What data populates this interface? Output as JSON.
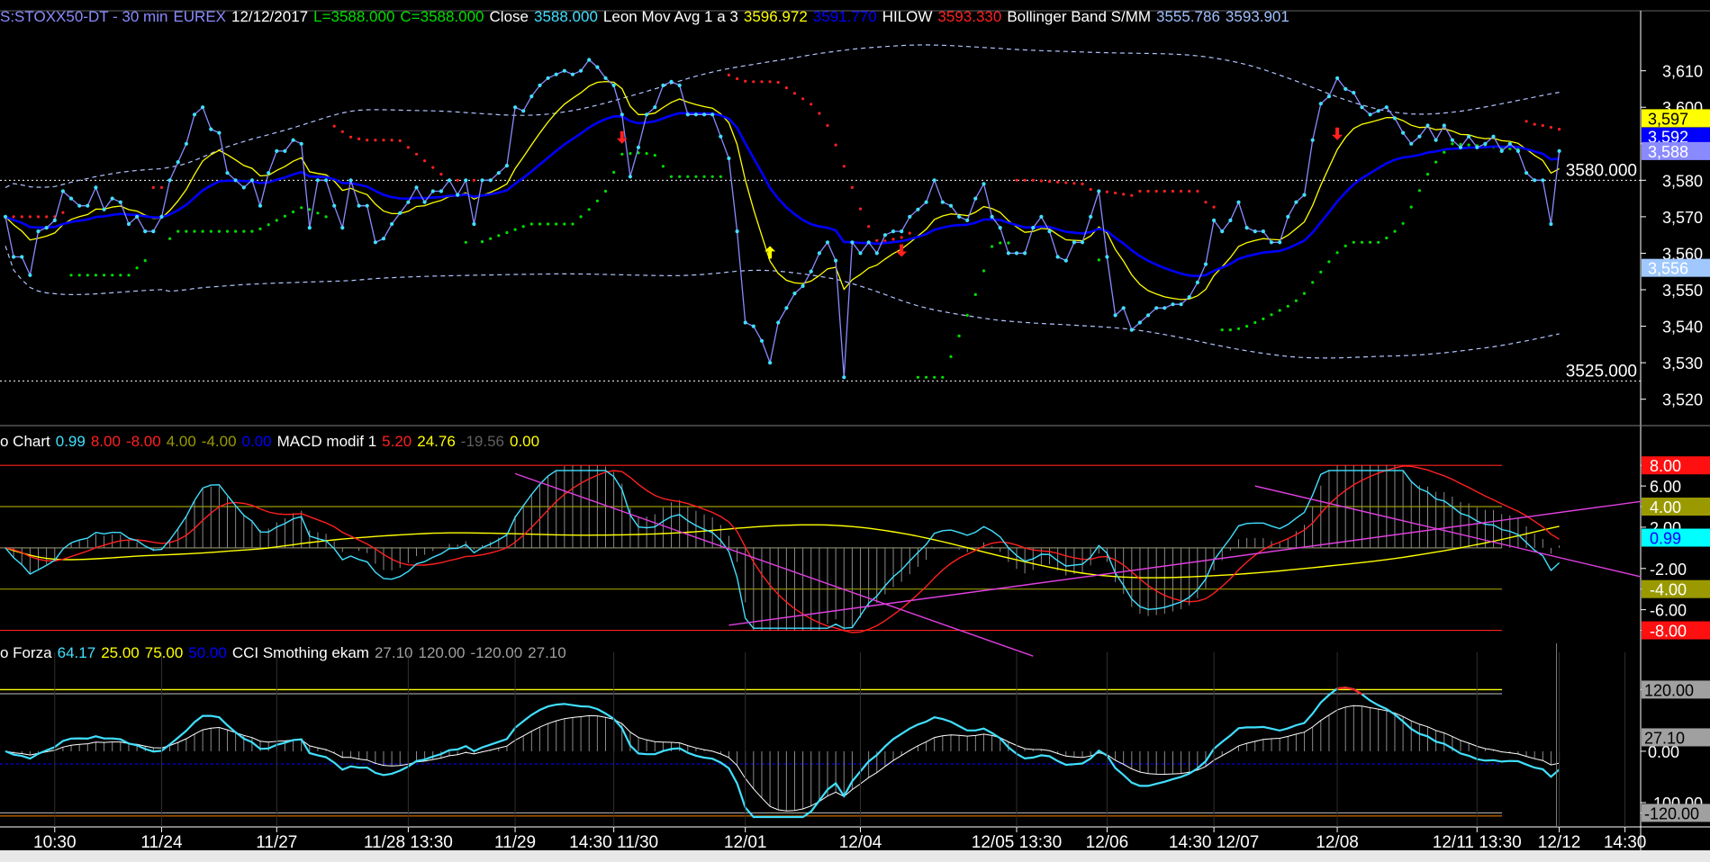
{
  "colors": {
    "background": "#000000",
    "price": "#8a8aff",
    "dots": "#40e0ff",
    "yellow": "#ffff00",
    "blue": "#0000ff",
    "red": "#ff2020",
    "green": "#00e000",
    "white": "#ffffff",
    "magenta": "#e040e0",
    "olive": "#9a9a00",
    "gray": "#a0a0a0"
  },
  "header": {
    "main": [
      {
        "text": "S:STOXX50-DT - 30 min",
        "color": "#8a8aff"
      },
      {
        "text": "EUREX",
        "color": "#8a8aff"
      },
      {
        "text": "12/12/2017",
        "color": "#ffffff"
      },
      {
        "text": "L=3588.000",
        "color": "#00e000"
      },
      {
        "text": "C=3588.000",
        "color": "#00e000"
      },
      {
        "text": "Close",
        "color": "#ffffff"
      },
      {
        "text": "3588.000",
        "color": "#40e0ff"
      },
      {
        "text": "Leon Mov Avg 1 a 3",
        "color": "#ffffff"
      },
      {
        "text": "3596.972",
        "color": "#ffff00"
      },
      {
        "text": "3591.770",
        "color": "#0000ff"
      },
      {
        "text": "HILOW",
        "color": "#ffffff"
      },
      {
        "text": "3593.330",
        "color": "#ff2020"
      },
      {
        "text": "Bollinger Band S/MM",
        "color": "#ffffff"
      },
      {
        "text": "3555.786",
        "color": "#a0c0ff"
      },
      {
        "text": "3593.901",
        "color": "#a0c0ff"
      }
    ],
    "macd": [
      {
        "text": "o Chart",
        "color": "#ffffff"
      },
      {
        "text": "0.99",
        "color": "#40e0ff"
      },
      {
        "text": "8.00",
        "color": "#ff2020"
      },
      {
        "text": "-8.00",
        "color": "#ff2020"
      },
      {
        "text": "4.00",
        "color": "#9a9a00"
      },
      {
        "text": "-4.00",
        "color": "#9a9a00"
      },
      {
        "text": "0.00",
        "color": "#0000ff"
      },
      {
        "text": "MACD modif 1",
        "color": "#ffffff"
      },
      {
        "text": "5.20",
        "color": "#ff2020"
      },
      {
        "text": "24.76",
        "color": "#ffff00"
      },
      {
        "text": "-19.56",
        "color": "#606060"
      },
      {
        "text": "0.00",
        "color": "#ffff00"
      }
    ],
    "cci": [
      {
        "text": "o Forza",
        "color": "#ffffff"
      },
      {
        "text": "64.17",
        "color": "#40e0ff"
      },
      {
        "text": "25.00",
        "color": "#ffff00"
      },
      {
        "text": "75.00",
        "color": "#ffff00"
      },
      {
        "text": "50.00",
        "color": "#0000ff"
      },
      {
        "text": "CCI Smothing ekam",
        "color": "#ffffff"
      },
      {
        "text": "27.10",
        "color": "#a0a0a0"
      },
      {
        "text": "120.00",
        "color": "#a0a0a0"
      },
      {
        "text": "-120.00",
        "color": "#a0a0a0"
      },
      {
        "text": "27.10",
        "color": "#a0a0a0"
      }
    ]
  },
  "chart_data": [
    {
      "type": "line",
      "panel": "price",
      "ylim": [
        3514,
        3622
      ],
      "y_ticks": [
        3520,
        3530,
        3540,
        3550,
        3560,
        3570,
        3580,
        3590,
        3600,
        3610
      ],
      "y_tick_labels": [
        "3,520",
        "3,530",
        "3,540",
        "3,550",
        "3,560",
        "3,570",
        "3,580",
        "3,590",
        "3,600",
        "3,610"
      ],
      "x_tick_labels": [
        {
          "label": "10:30",
          "i": 6
        },
        {
          "label": "11/24",
          "i": 19
        },
        {
          "label": "11/27",
          "i": 33
        },
        {
          "label": "11/28 13:30",
          "i": 49
        },
        {
          "label": "11/29",
          "i": 62
        },
        {
          "label": "14:30 11/30",
          "i": 74
        },
        {
          "label": "12/01",
          "i": 90
        },
        {
          "label": "12/04",
          "i": 104
        },
        {
          "label": "12/05 13:30",
          "i": 123
        },
        {
          "label": "12/06",
          "i": 134
        },
        {
          "label": "14:30 12/07",
          "i": 147
        },
        {
          "label": "12/08",
          "i": 162
        },
        {
          "label": "12/11 13:30",
          "i": 179
        },
        {
          "label": "12/12",
          "i": 189
        },
        {
          "label": "14:30",
          "i": 197
        }
      ],
      "h_levels": [
        {
          "value": 3580,
          "label": "3580.000"
        },
        {
          "value": 3525,
          "label": "3525.000"
        }
      ],
      "value_tags": [
        {
          "label": "3,597",
          "value": 3597,
          "bg": "#ffff00",
          "fg": "#000000"
        },
        {
          "label": "3,592",
          "value": 3592,
          "bg": "#0000ff",
          "fg": "#ffffff"
        },
        {
          "label": "3,588",
          "value": 3588,
          "bg": "#8a8aff",
          "fg": "#ffffff"
        },
        {
          "label": "3,556",
          "value": 3556,
          "bg": "#a0c8ff",
          "fg": "#ffffff"
        }
      ],
      "series": [
        {
          "name": "Close",
          "values": [
            3570,
            3559,
            3559,
            3554,
            3566,
            3567,
            3569,
            3577,
            3575,
            3573,
            3573,
            3578,
            3572,
            3575,
            3574,
            3568,
            3570,
            3566,
            3566,
            3570,
            3580,
            3585,
            3590,
            3598,
            3600,
            3594,
            3593,
            3582,
            3580,
            3578,
            3580,
            3573,
            3582,
            3588,
            3588,
            3591,
            3590,
            3567,
            3580,
            3580,
            3573,
            3567,
            3580,
            3573,
            3573,
            3563,
            3564,
            3568,
            3571,
            3574,
            3578,
            3574,
            3577,
            3577,
            3580,
            3576,
            3580,
            3568,
            3580,
            3580,
            3582,
            3584,
            3600,
            3599,
            3603,
            3606,
            3608,
            3609,
            3610,
            3609,
            3610,
            3613,
            3611,
            3608,
            3606,
            3598,
            3581,
            3589,
            3598,
            3600,
            3606,
            3607,
            3606,
            3598,
            3598,
            3598,
            3598,
            3592,
            3586,
            3566,
            3541,
            3540,
            3536,
            3530,
            3541,
            3545,
            3549,
            3551,
            3555,
            3560,
            3563,
            3558,
            3526,
            3563,
            3560,
            3563,
            3560,
            3565,
            3566,
            3566,
            3570,
            3572,
            3574,
            3580,
            3574,
            3573,
            3570,
            3569,
            3575,
            3579,
            3570,
            3567,
            3560,
            3560,
            3560,
            3567,
            3570,
            3566,
            3559,
            3558,
            3563,
            3563,
            3570,
            3577,
            3559,
            3543,
            3545,
            3539,
            3541,
            3543,
            3545,
            3545,
            3546,
            3546,
            3548,
            3552,
            3557,
            3569,
            3566,
            3569,
            3574,
            3567,
            3566,
            3566,
            3563,
            3563,
            3570,
            3574,
            3576,
            3591,
            3601,
            3603,
            3608,
            3605,
            3604,
            3600,
            3598,
            3599,
            3600,
            3597,
            3593,
            3590,
            3592,
            3595,
            3591,
            3595,
            3591,
            3589,
            3592,
            3589,
            3590,
            3592,
            3588,
            3590,
            3588,
            3582,
            3580,
            3580,
            3568,
            3588
          ]
        },
        {
          "name": "Leon Mov Avg 1 a 3 (yellow)",
          "color": "#ffff00"
        },
        {
          "name": "Leon Mov Avg 1 a 3 (blue)",
          "color": "#0000ff"
        },
        {
          "name": "HILOW",
          "color": "#ff2020"
        },
        {
          "name": "Bollinger Band S/MM",
          "color": "#a0c0ff"
        }
      ],
      "arrows": [
        {
          "i": 75,
          "value": 3590,
          "dir": "down",
          "color": "#ff2020"
        },
        {
          "i": 93,
          "value": 3562,
          "dir": "up",
          "color": "#ffff00"
        },
        {
          "i": 109,
          "value": 3559,
          "dir": "down",
          "color": "#ff2020"
        },
        {
          "i": 162,
          "value": 3591,
          "dir": "down",
          "color": "#ff2020"
        }
      ]
    },
    {
      "type": "line",
      "panel": "macd",
      "ylim": [
        -9,
        9.5
      ],
      "y_tick_labels": [
        "8.00",
        "6.00",
        "4.00",
        "2.00",
        "-2.00",
        "-4.00",
        "-6.00",
        "-8.00"
      ],
      "y_ticks": [
        8,
        6,
        4,
        2,
        -2,
        -4,
        -6,
        -8
      ],
      "value_tags": [
        {
          "label": "8.00",
          "value": 8,
          "bg": "#ff1010",
          "fg": "#ffffff"
        },
        {
          "label": "4.00",
          "value": 4,
          "bg": "#9a9a00",
          "fg": "#ffffff"
        },
        {
          "label": "0.99",
          "value": 0.99,
          "bg": "#00ffff",
          "fg": "#0000ff"
        },
        {
          "label": "-4.00",
          "value": -4,
          "bg": "#9a9a00",
          "fg": "#ffffff"
        },
        {
          "label": "-8.00",
          "value": -8,
          "bg": "#ff1010",
          "fg": "#ffffff"
        }
      ],
      "h_levels": [
        8,
        4,
        0,
        -4,
        -8
      ],
      "series": [
        {
          "name": "0.99",
          "color": "#40e0ff"
        },
        {
          "name": "MACD modif 1",
          "color": "#ff2020"
        }
      ]
    },
    {
      "type": "line",
      "panel": "cci",
      "ylim": [
        -135,
        175
      ],
      "y_tick_labels": [
        "120.00",
        "0.00",
        "-100.00",
        "-120.00"
      ],
      "y_ticks": [
        120,
        0,
        -100,
        -120
      ],
      "value_tags": [
        {
          "label": "120.00",
          "value": 120,
          "bg": "#a0a0a0",
          "fg": "#000000"
        },
        {
          "label": "27.10",
          "value": 27.1,
          "bg": "#a0a0a0",
          "fg": "#000000"
        },
        {
          "label": "-120.00",
          "value": -120,
          "bg": "#a0a0a0",
          "fg": "#000000"
        }
      ],
      "h_levels": [
        120,
        0,
        -120
      ],
      "series": [
        {
          "name": "CCI Smothing ekam",
          "color": "#40e0ff"
        },
        {
          "name": "120.00",
          "color": "#ff2020"
        }
      ]
    }
  ]
}
